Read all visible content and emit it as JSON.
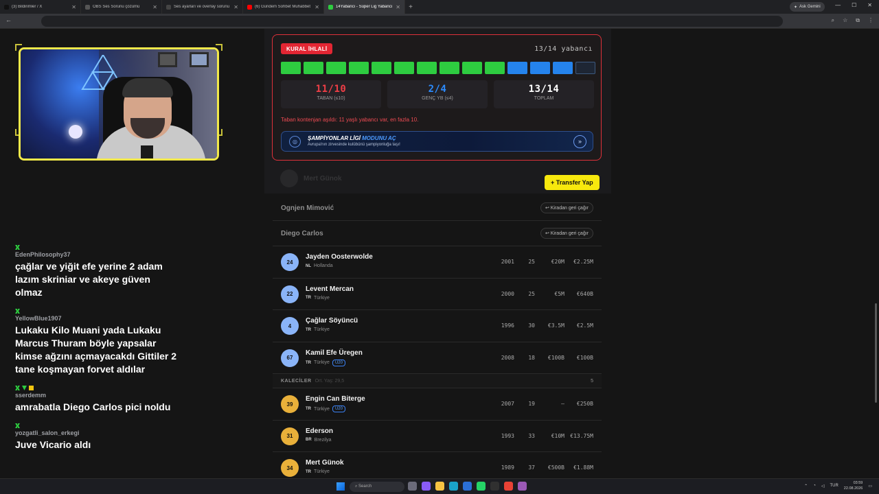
{
  "browser": {
    "tabs": [
      {
        "label": "(3) Bildirimler / X",
        "color": "#111111",
        "active": false
      },
      {
        "label": "OBS Ses Sorunu çözümü",
        "color": "#555555",
        "active": false
      },
      {
        "label": "Ses ayarları ve overlay sorunu",
        "color": "#444444",
        "active": false
      },
      {
        "label": "(6) Gündem Sohbet Muhabbet",
        "color": "#ff0000",
        "active": false
      },
      {
        "label": "14Yabancı - Süper Lig Yabancı",
        "color": "#2ecc40",
        "active": true
      }
    ],
    "gemini_label": "Ask Gemini",
    "url_hint": "14yabanci.com/superlig"
  },
  "rule_panel": {
    "badge": "KURAL İHLALİ",
    "count_text": "13/14 yabancı",
    "slots": {
      "green": 10,
      "blue": 3,
      "empty": 1
    },
    "stats": [
      {
        "value": "11/10",
        "label": "TABAN (≤10)",
        "color": "#ef3e46"
      },
      {
        "value": "2/4",
        "label": "GENÇ YB (≤4)",
        "color": "#2c8cff"
      },
      {
        "value": "13/14",
        "label": "TOPLAM",
        "color": "#ffffff"
      }
    ],
    "message": "Taban kontenjan aşıldı: 11 yaşlı yabancı var, en fazla 10.",
    "banner": {
      "title_prefix": "ŞAMPİYONLAR LİGİ",
      "title_accent": "MODUNU AÇ",
      "subtitle": "Avrupa'nın zirvesinde kulübünü şampiyonluğa taşı!"
    }
  },
  "faded_row": {
    "name": "Mert Günok"
  },
  "transfer_button": "+ Transfer Yap",
  "loaned": [
    {
      "name": "Ognjen Mimović",
      "action": "↩ Kiradan geri çağır"
    },
    {
      "name": "Diego Carlos",
      "action": "↩ Kiradan geri çağır"
    }
  ],
  "players": [
    {
      "number": "24",
      "name": "Jayden Oosterwolde",
      "cc": "NL",
      "country": "Hollanda",
      "u20": "",
      "year": "2001",
      "age": "25",
      "value": "€20M",
      "salary": "€2.25M"
    },
    {
      "number": "22",
      "name": "Levent Mercan",
      "cc": "TR",
      "country": "Türkiye",
      "u20": "",
      "year": "2000",
      "age": "25",
      "value": "€5M",
      "salary": "€640B"
    },
    {
      "number": "4",
      "name": "Çağlar Söyüncü",
      "cc": "TR",
      "country": "Türkiye",
      "u20": "",
      "year": "1996",
      "age": "30",
      "value": "€3.5M",
      "salary": "€2.5M"
    },
    {
      "number": "67",
      "name": "Kamil Efe Üregen",
      "cc": "TR",
      "country": "Türkiye",
      "u20": "U20",
      "year": "2008",
      "age": "18",
      "value": "€100B",
      "salary": "€100B"
    }
  ],
  "keepers_section": {
    "title": "KALECİLER",
    "subtitle": "Ort. Yaş: 29,5",
    "count": "5"
  },
  "keepers": [
    {
      "number": "39",
      "name": "Engin Can Biterge",
      "cc": "TR",
      "country": "Türkiye",
      "u20": "U20",
      "year": "2007",
      "age": "19",
      "value": "–",
      "salary": "€250B"
    },
    {
      "number": "31",
      "name": "Ederson",
      "cc": "BR",
      "country": "Brezilya",
      "u20": "",
      "year": "1993",
      "age": "33",
      "value": "€10M",
      "salary": "€13.75M"
    },
    {
      "number": "34",
      "name": "Mert Günok",
      "cc": "TR",
      "country": "Türkiye",
      "u20": "",
      "year": "1989",
      "age": "37",
      "value": "€500B",
      "salary": "€1.88M"
    }
  ],
  "chat": [
    {
      "user": "EdenPhilosophy37",
      "badges": [
        "green"
      ],
      "text": "çağlar ve yiğit efe yerine 2 adam lazım skriniar ve akeye güven olmaz"
    },
    {
      "user": "YellowBlue1907",
      "badges": [
        "green"
      ],
      "text": "Lukaku Kilo Muani yada Lukaku Marcus Thuram böyle yapsalar kimse ağzını açmayacakdı Gittiler 2 tane koşmayan forvet aldılar"
    },
    {
      "user": "sserdemm",
      "badges": [
        "green",
        "arrow",
        "crown"
      ],
      "text": "amrabatla Diego Carlos pici noldu"
    },
    {
      "user": "yozgatli_salon_erkegi",
      "badges": [
        "green"
      ],
      "text": "Juve Vicario aldı"
    }
  ],
  "taskbar": {
    "search": "Search",
    "lang": "TUR",
    "time": "03:59",
    "date": "22.08.2026"
  }
}
